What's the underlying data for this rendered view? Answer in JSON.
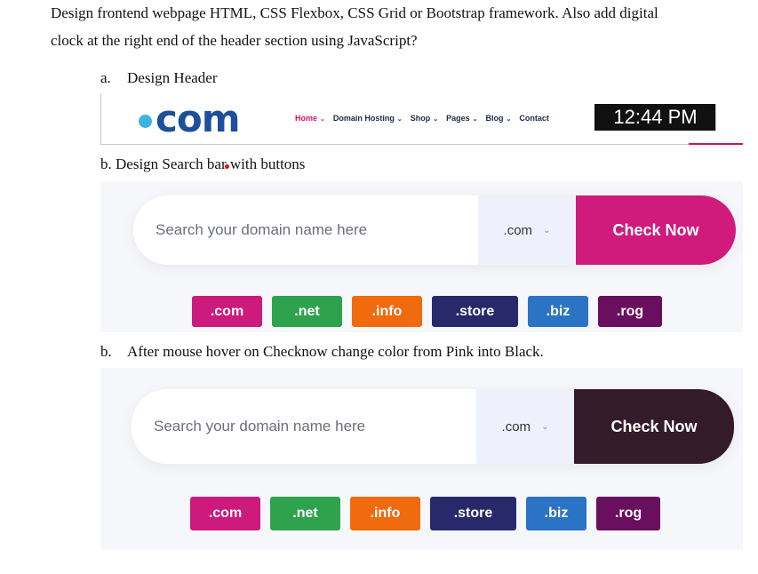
{
  "question": {
    "line1": "Design frontend webpage HTML, CSS Flexbox, CSS Grid or Bootstrap framework. Also add digital",
    "line2": "clock at the right end of the header section using JavaScript?"
  },
  "section_a": {
    "marker": "a.",
    "title": "Design Header"
  },
  "section_b": {
    "text": "b. Design Search bar with buttons"
  },
  "section_c": {
    "marker": "b.",
    "title": "After mouse hover on Checknow change color from Pink into Black."
  },
  "header": {
    "logo_text": "com",
    "nav": [
      "Home",
      "Domain Hosting",
      "Shop",
      "Pages",
      "Blog",
      "Contact"
    ],
    "nav_dropdown": [
      true,
      true,
      true,
      true,
      true,
      false
    ],
    "clock": "12:44 PM"
  },
  "search": {
    "placeholder": "Search your domain name here",
    "selected_extension": ".com",
    "button_label": "Check Now",
    "button_color_default": "#d01a7c",
    "button_color_hover": "#331b2a"
  },
  "tags": [
    {
      "label": ".com",
      "color": "#cc1a7d"
    },
    {
      "label": ".net",
      "color": "#2fa24d"
    },
    {
      "label": ".info",
      "color": "#f06a0e"
    },
    {
      "label": ".store",
      "color": "#28296b"
    },
    {
      "label": ".biz",
      "color": "#2b73c4"
    },
    {
      "label": ".rog",
      "color": "#6a0f5e"
    }
  ]
}
